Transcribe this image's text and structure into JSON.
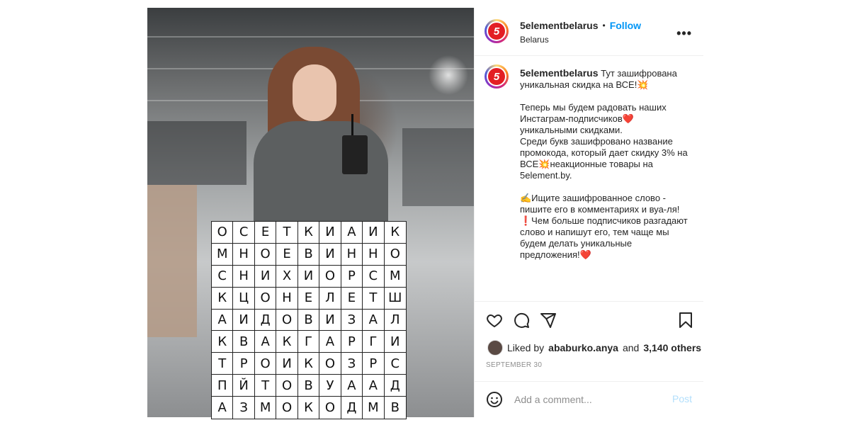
{
  "account": {
    "username": "5elementbelarus",
    "separator": "•",
    "follow_label": "Follow",
    "location": "Belarus",
    "logo_text": "5"
  },
  "menu": {
    "more_label": "•••"
  },
  "caption": {
    "username": "5elementbelarus",
    "text": "Тут зашифрована уникальная скидка на ВСЕ!💥\n\nТеперь мы будем радовать наших Инстаграм-подписчиков❤️ уникальными скидками.\nСреди букв зашифровано название промокода, который дает скидку 3% на ВСЕ💥неакционные товары на 5element.by.\n\n✍️Ищите зашифрованное слово - пишите его в комментариях и вуа-ля!\n❗Чем больше подписчиков разгадают слово и напишут его, тем чаще мы будем делать уникальные предложения!❤️"
  },
  "likes": {
    "prefix": "Liked by",
    "user": "ababurko.anya",
    "conjunction": "and",
    "others": "3,140 others"
  },
  "date": "SEPTEMBER 30",
  "comment": {
    "placeholder": "Add a comment...",
    "post_label": "Post"
  },
  "icons": {
    "like": "heart-icon",
    "comment": "comment-icon",
    "share": "share-icon",
    "save": "bookmark-icon",
    "emoji": "emoji-icon"
  },
  "puzzle": {
    "rows": [
      [
        "О",
        "С",
        "Е",
        "Т",
        "К",
        "И",
        "А",
        "И",
        "К"
      ],
      [
        "М",
        "Н",
        "О",
        "Е",
        "В",
        "И",
        "Н",
        "Н",
        "О"
      ],
      [
        "С",
        "Н",
        "И",
        "Х",
        "И",
        "О",
        "Р",
        "С",
        "М"
      ],
      [
        "К",
        "Ц",
        "О",
        "Н",
        "Е",
        "Л",
        "Е",
        "Т",
        "Ш"
      ],
      [
        "А",
        "И",
        "Д",
        "О",
        "В",
        "И",
        "З",
        "А",
        "Л"
      ],
      [
        "К",
        "В",
        "А",
        "К",
        "Г",
        "А",
        "Р",
        "Г",
        "И"
      ],
      [
        "Т",
        "Р",
        "О",
        "И",
        "К",
        "О",
        "З",
        "Р",
        "С"
      ],
      [
        "П",
        "Й",
        "Т",
        "О",
        "В",
        "У",
        "А",
        "А",
        "Д"
      ],
      [
        "А",
        "З",
        "М",
        "О",
        "К",
        "О",
        "Д",
        "М",
        "В"
      ]
    ]
  },
  "colors": {
    "brand_red": "#e31e24",
    "link_blue": "#0095f6",
    "post_disabled": "#b2dffc"
  }
}
